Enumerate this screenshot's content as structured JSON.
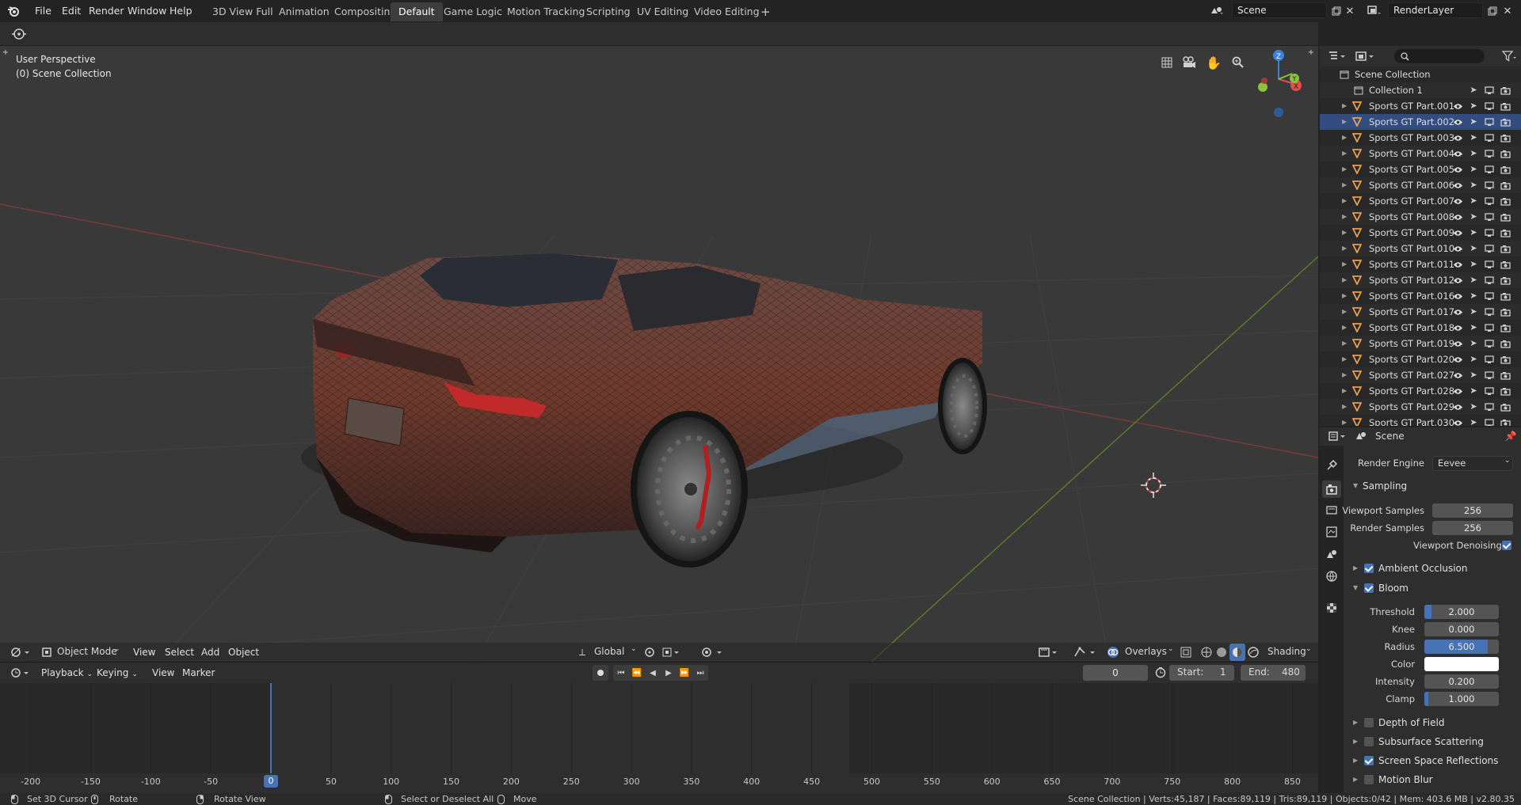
{
  "topbar": {
    "menus": [
      "File",
      "Edit",
      "Render",
      "Window",
      "Help"
    ],
    "workspaces": [
      "3D View Full",
      "Animation",
      "Compositing",
      "Default",
      "Game Logic",
      "Motion Tracking",
      "Scripting",
      "UV Editing",
      "Video Editing"
    ],
    "active_workspace": "Default",
    "add_workspace": "+",
    "scene": "Scene",
    "view_layer": "RenderLayer"
  },
  "viewport": {
    "view_name": "User Perspective",
    "collection_label": "(0) Scene Collection",
    "gizmo": {
      "z": "Z",
      "y": "Y",
      "x": "X"
    },
    "header": {
      "mode": "Object Mode",
      "menus": [
        "View",
        "Select",
        "Add",
        "Object"
      ],
      "orientation": "Global",
      "overlays": "Overlays",
      "shading": "Shading"
    }
  },
  "timeline": {
    "menus": [
      "Playback",
      "Keying",
      "View",
      "Marker"
    ],
    "current_frame": "0",
    "start_label": "Start:",
    "start": "1",
    "end_label": "End:",
    "end": "480",
    "ruler": [
      "-200",
      "-150",
      "-100",
      "-50",
      "0",
      "50",
      "100",
      "150",
      "200",
      "250",
      "300",
      "350",
      "400",
      "450",
      "500",
      "550",
      "600",
      "650",
      "700",
      "750",
      "800",
      "850"
    ],
    "cursor_frame": "0"
  },
  "outliner": {
    "root": "Scene Collection",
    "collection": "Collection 1",
    "items": [
      "Sports GT Part.001",
      "Sports GT Part.002",
      "Sports GT Part.003",
      "Sports GT Part.004",
      "Sports GT Part.005",
      "Sports GT Part.006",
      "Sports GT Part.007",
      "Sports GT Part.008",
      "Sports GT Part.009",
      "Sports GT Part.010",
      "Sports GT Part.011",
      "Sports GT Part.012",
      "Sports GT Part.016",
      "Sports GT Part.017",
      "Sports GT Part.018",
      "Sports GT Part.019",
      "Sports GT Part.020",
      "Sports GT Part.027",
      "Sports GT Part.028",
      "Sports GT Part.029",
      "Sports GT Part.030"
    ],
    "selected_index": 1
  },
  "properties": {
    "context": "Scene",
    "render_engine_label": "Render Engine",
    "render_engine": "Eevee",
    "sampling": {
      "title": "Sampling",
      "viewport_samples_label": "Viewport Samples",
      "viewport_samples": "256",
      "render_samples_label": "Render Samples",
      "render_samples": "256",
      "viewport_denoising_label": "Viewport Denoising",
      "viewport_denoising": true
    },
    "ambient_occlusion": {
      "title": "Ambient Occlusion",
      "enabled": true
    },
    "bloom": {
      "title": "Bloom",
      "enabled": true,
      "threshold_label": "Threshold",
      "threshold": "2.000",
      "threshold_fill": 0.1,
      "knee_label": "Knee",
      "knee": "0.000",
      "radius_label": "Radius",
      "radius": "6.500",
      "radius_fill": 0.85,
      "color_label": "Color",
      "color": "#ffffff",
      "intensity_label": "Intensity",
      "intensity": "0.200",
      "clamp_label": "Clamp",
      "clamp": "1.000",
      "clamp_fill": 0.05
    },
    "closed_panels": [
      {
        "title": "Depth of Field",
        "enabled": false
      },
      {
        "title": "Subsurface Scattering",
        "enabled": false
      },
      {
        "title": "Screen Space Reflections",
        "enabled": true
      },
      {
        "title": "Motion Blur",
        "enabled": false
      }
    ]
  },
  "statusbar": {
    "hints": [
      "Set 3D Cursor",
      "Rotate",
      "Rotate View",
      "Select or Deselect All",
      "Move"
    ],
    "stats": "Scene Collection | Verts:45,187 | Faces:89,119 | Tris:89,119 | Objects:0/42 | Mem: 403.6 MB | v2.80.35"
  },
  "colors": {
    "accent": "#4772b3",
    "selected_row": "#334d80",
    "object_icon": "#e8a050",
    "x_axis": "#e64c4c",
    "y_axis": "#8ac23b",
    "z_axis": "#3b82d8"
  }
}
